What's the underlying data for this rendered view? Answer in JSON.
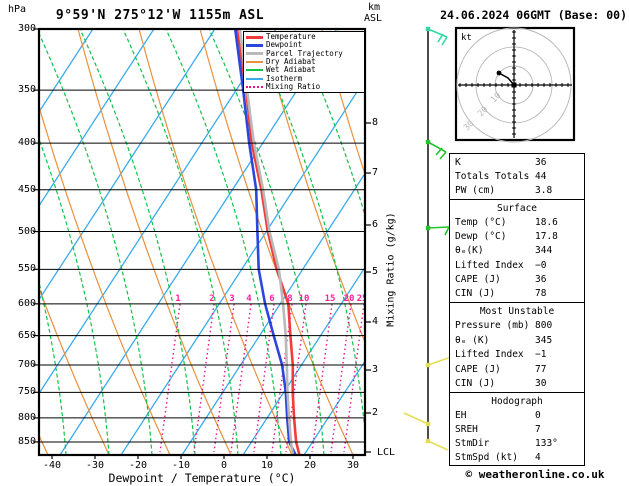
{
  "title": "9°59'N 275°12'W 1155m ASL",
  "datetime": "24.06.2024 06GMT (Base: 00)",
  "footer": "© weatheronline.co.uk",
  "axes": {
    "pressure_unit": "hPa",
    "pressure_ticks": [
      300,
      350,
      400,
      450,
      500,
      550,
      600,
      650,
      700,
      750,
      800,
      850
    ],
    "temp_ticks": [
      -40,
      -30,
      -20,
      -10,
      0,
      10,
      20,
      30
    ],
    "xlabel": "Dewpoint / Temperature (°C)",
    "altitude_unit_line1": "km",
    "altitude_unit_line2": "ASL",
    "altitude_ticks_km": [
      8,
      7,
      6,
      5,
      4,
      3,
      2
    ],
    "lcl_label": "LCL",
    "mixing_ratio_axis_label": "Mixing Ratio (g/kg)",
    "mixing_ratio_ticks": [
      1,
      2,
      3,
      4,
      6,
      8,
      10,
      15,
      20,
      25
    ]
  },
  "legend": [
    {
      "label": "Temperature",
      "color": "#f23c3c",
      "style": "thick"
    },
    {
      "label": "Dewpoint",
      "color": "#2b46dd",
      "style": "thick"
    },
    {
      "label": "Parcel Trajectory",
      "color": "#b9b9b9",
      "style": "thick"
    },
    {
      "label": "Dry Adiabat",
      "color": "#e8913e",
      "style": "thin"
    },
    {
      "label": "Wet Adiabat",
      "color": "#11c24b",
      "style": "thin"
    },
    {
      "label": "Isotherm",
      "color": "#3aabec",
      "style": "thin"
    },
    {
      "label": "Mixing Ratio",
      "color": "#e8158c",
      "style": "dotted"
    }
  ],
  "palette": {
    "temperature": "#f23c3c",
    "dewpoint": "#2b46dd",
    "parcel": "#b9b9b9",
    "dry_adiabat": "#e8913e",
    "wet_adiabat": "#11c24b",
    "isotherm": "#3aabec",
    "mixing_ratio": "#e8158c",
    "mixing_label": "#ff1f9c",
    "hodo_ring": "#b9b9b9",
    "barb_teal": "#2ed9a3",
    "barb_green": "#22c52a",
    "barb_yellow": "#e3df55"
  },
  "hodograph": {
    "unit": "kt",
    "ring_labels": [
      10,
      20,
      30
    ]
  },
  "wind_barbs": [
    "teal",
    "green",
    "green",
    "yellow",
    "yellow",
    "yellow"
  ],
  "panels": [
    {
      "header": null,
      "rows": [
        [
          "K",
          "36"
        ],
        [
          "Totals Totals",
          "44"
        ],
        [
          "PW (cm)",
          "3.8"
        ]
      ]
    },
    {
      "header": "Surface",
      "rows": [
        [
          "Temp (°C)",
          "18.6"
        ],
        [
          "Dewp (°C)",
          "17.8"
        ],
        [
          "θₑ(K)",
          "344"
        ],
        [
          "Lifted Index",
          "−0"
        ],
        [
          "CAPE (J)",
          "36"
        ],
        [
          "CIN (J)",
          "78"
        ]
      ]
    },
    {
      "header": "Most Unstable",
      "rows": [
        [
          "Pressure (mb)",
          "800"
        ],
        [
          "θₑ (K)",
          "345"
        ],
        [
          "Lifted Index",
          "−1"
        ],
        [
          "CAPE (J)",
          "77"
        ],
        [
          "CIN (J)",
          "30"
        ]
      ]
    },
    {
      "header": "Hodograph",
      "rows": [
        [
          "EH",
          "0"
        ],
        [
          "SREH",
          "7"
        ],
        [
          "StmDir",
          "133°"
        ],
        [
          "StmSpd (kt)",
          "4"
        ]
      ]
    }
  ],
  "chart_data": {
    "type": "line",
    "subtype": "skew-t log-p sounding",
    "title": "9°59'N 275°12'W 1155m ASL",
    "xlabel": "Dewpoint / Temperature (°C)",
    "ylabel": "hPa",
    "x_range_at_bottom_C": [
      -43,
      33
    ],
    "pressure_range_hPa": [
      300,
      878
    ],
    "pressure_scale": "log",
    "grid": "pressure lines every 50 hPa",
    "legend_position": "top-right inside plot",
    "pressure_levels": [
      878,
      850,
      800,
      750,
      700,
      650,
      600,
      550,
      500,
      450,
      400,
      350,
      300
    ],
    "series": [
      {
        "name": "Temperature",
        "color": "#f23c3c",
        "values": [
          17.5,
          14.8,
          10.7,
          6.5,
          2.4,
          -2.6,
          -7.9,
          -15.8,
          -23.6,
          -31.4,
          -40.7,
          -50.0,
          -61.4
        ]
      },
      {
        "name": "Dewpoint",
        "color": "#2b46dd",
        "values": [
          16.6,
          13.2,
          9.1,
          4.9,
          -0.1,
          -6.5,
          -13.3,
          -20.0,
          -26.0,
          -32.6,
          -41.3,
          -50.7,
          -61.8
        ]
      },
      {
        "name": "Parcel Trajectory",
        "color": "#b9b9b9",
        "values": [
          16.0,
          13.6,
          9.5,
          5.3,
          1.0,
          -3.7,
          -9.1,
          -15.3,
          -23.2,
          -31.0,
          -40.2,
          -49.8,
          -60.7
        ]
      }
    ],
    "surface": {
      "temp_C": 18.6,
      "dewp_C": 17.8
    },
    "mixing_ratio_lines_g_kg": [
      1,
      2,
      3,
      4,
      6,
      8,
      10,
      15,
      20,
      25
    ],
    "altitude_ticks_km": [
      8,
      7,
      6,
      5,
      4,
      3,
      2
    ]
  }
}
